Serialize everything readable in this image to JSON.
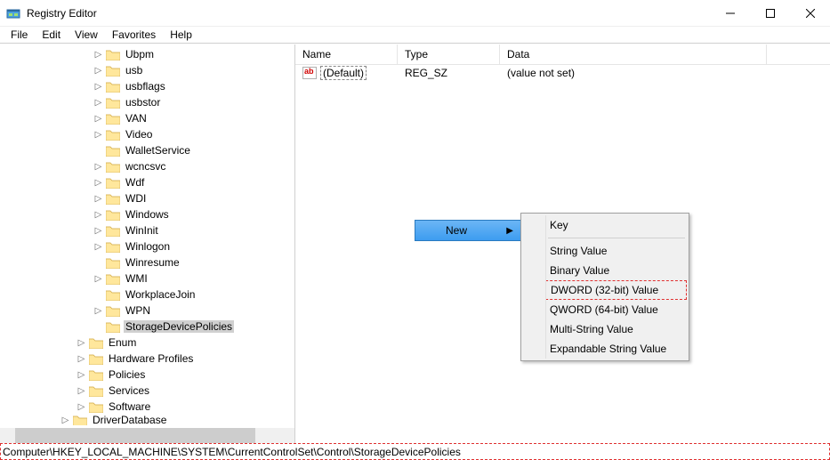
{
  "window": {
    "title": "Registry Editor"
  },
  "menu": {
    "file": "File",
    "edit": "Edit",
    "view": "View",
    "favorites": "Favorites",
    "help": "Help"
  },
  "tree": {
    "items": [
      {
        "indent": 104,
        "expander": ">",
        "label": "Ubpm"
      },
      {
        "indent": 104,
        "expander": ">",
        "label": "usb"
      },
      {
        "indent": 104,
        "expander": ">",
        "label": "usbflags"
      },
      {
        "indent": 104,
        "expander": ">",
        "label": "usbstor"
      },
      {
        "indent": 104,
        "expander": ">",
        "label": "VAN"
      },
      {
        "indent": 104,
        "expander": ">",
        "label": "Video"
      },
      {
        "indent": 104,
        "expander": "",
        "label": "WalletService"
      },
      {
        "indent": 104,
        "expander": ">",
        "label": "wcncsvc"
      },
      {
        "indent": 104,
        "expander": ">",
        "label": "Wdf"
      },
      {
        "indent": 104,
        "expander": ">",
        "label": "WDI"
      },
      {
        "indent": 104,
        "expander": ">",
        "label": "Windows"
      },
      {
        "indent": 104,
        "expander": ">",
        "label": "WinInit"
      },
      {
        "indent": 104,
        "expander": ">",
        "label": "Winlogon"
      },
      {
        "indent": 104,
        "expander": "",
        "label": "Winresume"
      },
      {
        "indent": 104,
        "expander": ">",
        "label": "WMI"
      },
      {
        "indent": 104,
        "expander": "",
        "label": "WorkplaceJoin"
      },
      {
        "indent": 104,
        "expander": ">",
        "label": "WPN"
      },
      {
        "indent": 104,
        "expander": "",
        "label": "StorageDevicePolicies",
        "selected": true
      },
      {
        "indent": 85,
        "expander": ">",
        "label": "Enum"
      },
      {
        "indent": 85,
        "expander": ">",
        "label": "Hardware Profiles"
      },
      {
        "indent": 85,
        "expander": ">",
        "label": "Policies"
      },
      {
        "indent": 85,
        "expander": ">",
        "label": "Services"
      },
      {
        "indent": 85,
        "expander": ">",
        "label": "Software"
      },
      {
        "indent": 67,
        "expander": ">",
        "label": "DriverDatabase",
        "cut": true
      }
    ]
  },
  "list": {
    "columns": {
      "name": "Name",
      "type": "Type",
      "data": "Data"
    },
    "widths": {
      "name": 115,
      "type": 115,
      "data": 300
    },
    "rows": [
      {
        "name": "(Default)",
        "type": "REG_SZ",
        "data": "(value not set)",
        "default": true
      }
    ]
  },
  "contextParent": {
    "label": "New"
  },
  "contextSub": {
    "items": [
      {
        "label": "Key"
      },
      {
        "sep": true
      },
      {
        "label": "String Value"
      },
      {
        "label": "Binary Value"
      },
      {
        "label": "DWORD (32-bit) Value",
        "highlight": true
      },
      {
        "label": "QWORD (64-bit) Value"
      },
      {
        "label": "Multi-String Value"
      },
      {
        "label": "Expandable String Value"
      }
    ]
  },
  "statusbar": {
    "path": "Computer\\HKEY_LOCAL_MACHINE\\SYSTEM\\CurrentControlSet\\Control\\StorageDevicePolicies"
  }
}
